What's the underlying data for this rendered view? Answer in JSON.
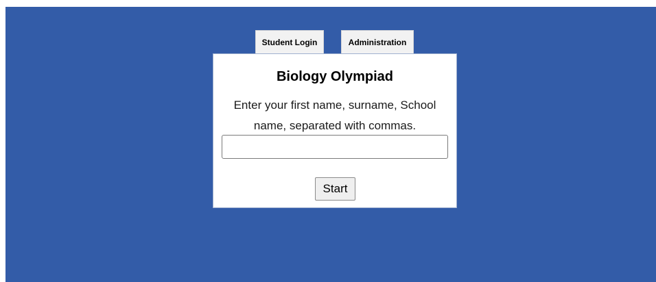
{
  "tabs": {
    "student_login": "Student Login",
    "administration": "Administration"
  },
  "panel": {
    "title": "Biology Olympiad",
    "instructions": "Enter your first name, surname, School name, separated with commas.",
    "input_value": "",
    "input_placeholder": "",
    "start_label": "Start"
  },
  "colors": {
    "background": "#335ca8",
    "panel": "#ffffff",
    "tab": "#f2f2f2"
  }
}
